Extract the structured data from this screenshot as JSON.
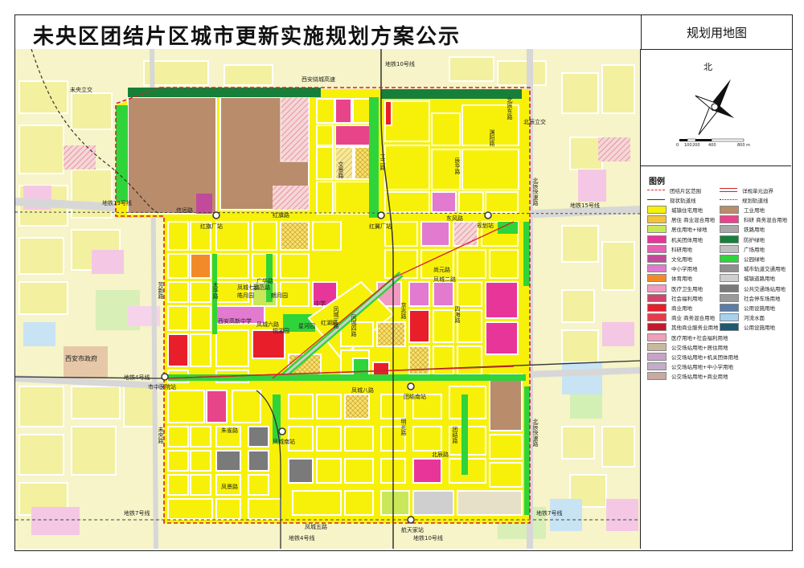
{
  "title": "未央区团结片区城市更新实施规划方案公示",
  "side_title": "规划用地图",
  "compass": {
    "north": "北",
    "scale_ticks": [
      "0",
      "100",
      "200",
      "400",
      "800 m"
    ]
  },
  "legend": {
    "title": "图例",
    "items": [
      {
        "label": "团结片区范围",
        "color": "#d9212a",
        "style": "dash"
      },
      {
        "label": "详规单元边界",
        "color": "#d9212a",
        "style": "double"
      },
      {
        "label": "现状轨道线",
        "color": "#333333",
        "style": "line"
      },
      {
        "label": "规划轨道线",
        "color": "#333333",
        "style": "dots"
      },
      {
        "label": "城镇住宅用地",
        "color": "#f7f10a"
      },
      {
        "label": "工业用地",
        "color": "#b98c6b"
      },
      {
        "label": "居住 商业混合用地",
        "color": "#f2c43a"
      },
      {
        "label": "科研 商务混合用地",
        "color": "#e8448a"
      },
      {
        "label": "居住用地+绿地",
        "color": "#c8e85a"
      },
      {
        "label": "铁路用地",
        "color": "#a8a8a8"
      },
      {
        "label": "机关团体用地",
        "color": "#e8359a"
      },
      {
        "label": "防护绿地",
        "color": "#16803a"
      },
      {
        "label": "科研用地",
        "color": "#e75fb3"
      },
      {
        "label": "广场用地",
        "color": "#bfbfbf"
      },
      {
        "label": "文化用地",
        "color": "#c24a9a"
      },
      {
        "label": "公园绿地",
        "color": "#2fd43a"
      },
      {
        "label": "中小学用地",
        "color": "#e27ad0"
      },
      {
        "label": "城市轨道交通用地",
        "color": "#8f8f8f"
      },
      {
        "label": "体育用地",
        "color": "#f28a2a"
      },
      {
        "label": "城镇道路用地",
        "color": "#cfcfcf"
      },
      {
        "label": "医疗卫生用地",
        "color": "#f19ac2"
      },
      {
        "label": "公共交通场站用地",
        "color": "#7a7a7a"
      },
      {
        "label": "社会福利用地",
        "color": "#d2456a"
      },
      {
        "label": "社会停车场用地",
        "color": "#9a9a9a"
      },
      {
        "label": "商业用地",
        "color": "#e81e2a"
      },
      {
        "label": "公用设施用地",
        "color": "#5c7da8"
      },
      {
        "label": "商业 商务混合用地",
        "color": "#e83a4a"
      },
      {
        "label": "河流水面",
        "color": "#a7d2ee"
      },
      {
        "label": "其他商业服务业用地",
        "color": "#c21a2a"
      },
      {
        "label": "公用设施用地",
        "color": "#1f5a6e"
      },
      {
        "label": "医疗用地+社会福利用地",
        "color": "#f0a0b8"
      },
      {
        "label": "公交场站用地+居住用地",
        "color": "#c8b8a0"
      },
      {
        "label": "公交场站用地+机关团体用地",
        "color": "#c9a2c9"
      },
      {
        "label": "公交场站用地+中小学用地",
        "color": "#c2aec8"
      },
      {
        "label": "公交场站用地+商业用地",
        "color": "#c9a9a0"
      }
    ]
  },
  "map": {
    "labels": {
      "metro10_top": "地铁10号线",
      "weiyang_interchange": "未央立交",
      "xian_ring_highway": "西安绕城高速",
      "beichen_interchange": "北辰立交",
      "metro19": "地铁19号线",
      "metro15": "地铁15号线",
      "metro4": "地铁4号线",
      "metro7_left": "地铁7号线",
      "metro7_right": "地铁7号线",
      "metro4_bottom": "地铁4号线",
      "metro10_bottom": "地铁10号线",
      "hongqi_station": "红旗厂站",
      "hongqi_rd": "红旗路",
      "hongyi_station": "红翼厂站",
      "guihua_station": "规划站",
      "shizhongyi_station": "市中医院站",
      "tuanjie_station": "团结南站",
      "fengcheng_station": "凤城南站",
      "hangtian_station": "航天家站",
      "fengcheng8": "凤城八路",
      "fengcheng5": "凤城五路",
      "beichen_expressway": "北辰快速路",
      "beichen_expressway2": "北辰快速路",
      "xian_gov": "西安市政府",
      "jingyue_park": "皓月园",
      "langyue_park": "朗月园",
      "xihu_park": "悦湖园",
      "xinghe_park": "星河园",
      "school": "西安高新中学",
      "zhongxue": "中学",
      "gonghe_rd": "工二路",
      "chenghua_rd": "辰华路",
      "wenjing_rd": "文景路",
      "weiyang_rd": "未央路",
      "taihua_rd": "太华路",
      "fangxin_rd": "芳新路",
      "fengcheng2": "凤城二路",
      "dongfeng_rd": "东风路",
      "jing_rd": "京兆路",
      "sihai_rd": "四海路",
      "ming_rd": "明光路",
      "tuanjie_rd": "团结路",
      "beichen_rd": "北辰路",
      "zhuque_rd": "朱雀路",
      "fengjing_rd": "凤景路",
      "fengcheng3": "凤城三路",
      "fengcheng4": "凤城四路",
      "fengcheng6": "凤城六路",
      "fengcheng7": "凤城七路",
      "shiyan_rd": "示范路",
      "guanghua_rd": "广华路",
      "beichen_dong": "北辰东路",
      "xinyuan_rd": "信远路",
      "shangyuan_rd": "尚元路",
      "yuanyang_rd": "渊阳路",
      "honghu_rd": "红湖路"
    }
  }
}
